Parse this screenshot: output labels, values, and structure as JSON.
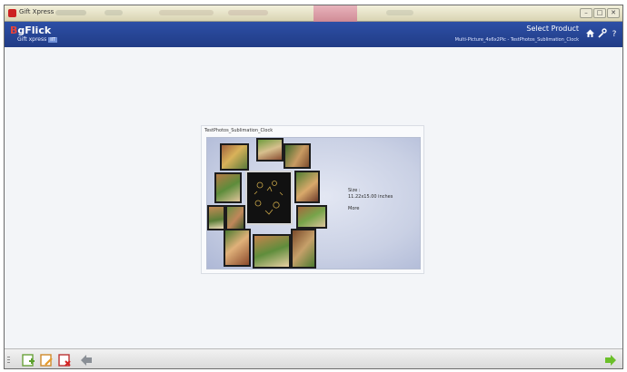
{
  "window": {
    "title": "Gift Xpress",
    "controls": [
      "–",
      "□",
      "✕"
    ]
  },
  "header": {
    "logo_prefix": "B",
    "logo_text": "gFlick",
    "logo_sub": "Gift xpress",
    "logo_badge": "IIT",
    "select_product": "Select Product",
    "breadcrumb": "Multi-Picture_4x6x2Pic - TestPhotos_Sublimation_Clock",
    "icons": [
      "home-icon",
      "tools-icon",
      "help-icon"
    ]
  },
  "product": {
    "title": "TestPhotos_Sublimation_Clock",
    "info": {
      "size_label": "Size :",
      "size_value": "11.22x15.00 inches",
      "more": "More"
    }
  },
  "toolbar": {
    "icons": [
      "add-image-icon",
      "edit-image-icon",
      "delete-image-icon",
      "back-arrow-icon",
      "next-arrow-icon"
    ]
  },
  "colors": {
    "header": "#2d4fa6",
    "next_arrow": "#6bbf2a",
    "back_arrow": "#8a8f96"
  }
}
